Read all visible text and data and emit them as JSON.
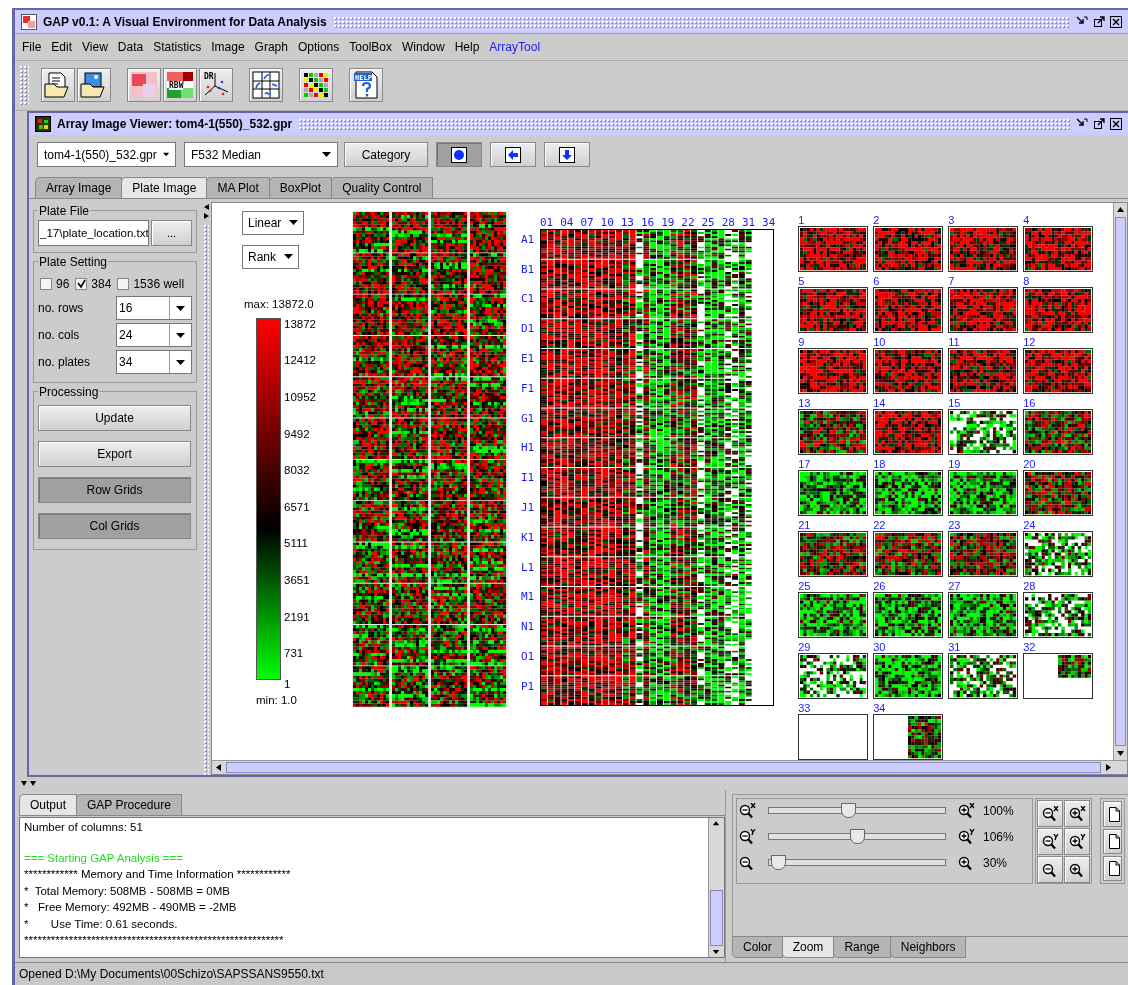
{
  "window": {
    "title": "GAP v0.1: A Visual Environment for Data Analysis"
  },
  "menu": [
    {
      "label": "File",
      "kind": "menu"
    },
    {
      "label": "Edit",
      "kind": "menu"
    },
    {
      "label": "View",
      "kind": "menu"
    },
    {
      "label": "Data",
      "kind": "menu"
    },
    {
      "label": "Statistics",
      "kind": "menu"
    },
    {
      "label": "Image",
      "kind": "menu"
    },
    {
      "label": "Graph",
      "kind": "menu"
    },
    {
      "label": "Options",
      "kind": "menu"
    },
    {
      "label": "ToolBox",
      "kind": "menu"
    },
    {
      "label": "Window",
      "kind": "menu"
    },
    {
      "label": "Help",
      "kind": "menu"
    },
    {
      "label": "ArrayTool",
      "kind": "plugin"
    }
  ],
  "toolbar": [
    {
      "kind": "open"
    },
    {
      "kind": "image"
    },
    {
      "kind": "matrix"
    },
    {
      "kind": "rbw",
      "caption": "RBW"
    },
    {
      "kind": "scatter",
      "caption": "DR"
    },
    {
      "kind": "grid"
    },
    {
      "kind": "palette"
    },
    {
      "kind": "help",
      "caption": "HELP"
    }
  ],
  "viewer": {
    "title": "Array Image Viewer: tom4-1(550)_532.gpr",
    "file_dropdown": "tom4-1(550)_532.gpr",
    "measure_dropdown": "F532 Median",
    "category_button": "Category",
    "tool_buttons": [
      {
        "kind": "dot",
        "selected": true
      },
      {
        "kind": "left",
        "selected": false
      },
      {
        "kind": "down",
        "selected": false
      }
    ],
    "tabs": [
      {
        "label": "Array Image",
        "selected": false
      },
      {
        "label": "Plate Image",
        "selected": true
      },
      {
        "label": "MA Plot",
        "selected": false
      },
      {
        "label": "BoxPlot",
        "selected": false
      },
      {
        "label": "Quality Control",
        "selected": false
      }
    ],
    "plate_file": {
      "title": "Plate File",
      "path": "_17\\plate_location.txt",
      "browse_button": "..."
    },
    "plate_setting": {
      "title": "Plate Setting",
      "wells": [
        {
          "label": "96",
          "checked": false
        },
        {
          "label": "384",
          "checked": true
        },
        {
          "label": "1536 well",
          "checked": false
        }
      ],
      "fields": [
        {
          "label": "no. rows",
          "value": "16"
        },
        {
          "label": "no. cols",
          "value": "24"
        },
        {
          "label": "no. plates",
          "value": "34"
        }
      ]
    },
    "processing": {
      "title": "Processing",
      "buttons": [
        {
          "label": "Update",
          "pressed": false
        },
        {
          "label": "Export",
          "pressed": false
        },
        {
          "label": "Row Grids",
          "pressed": true
        },
        {
          "label": "Col Grids",
          "pressed": true
        }
      ]
    },
    "scale_dropdown": "Linear",
    "order_dropdown": "Rank",
    "color_scale": {
      "max_label": "max: 13872.0",
      "ticks": [
        "13872",
        "12412",
        "10952",
        "9492",
        "8032",
        "6571",
        "5111",
        "3651",
        "2191",
        "731",
        "1"
      ],
      "min_label": "min: 1.0"
    },
    "plate_layout": {
      "columns": [
        "01",
        "04",
        "07",
        "10",
        "13",
        "16",
        "19",
        "22",
        "25",
        "28",
        "31",
        "34"
      ],
      "rows": [
        "A1",
        "B1",
        "C1",
        "D1",
        "E1",
        "F1",
        "G1",
        "H1",
        "I1",
        "J1",
        "K1",
        "L1",
        "M1",
        "N1",
        "O1",
        "P1"
      ]
    },
    "plates": [
      {
        "label": "1",
        "kind": "high"
      },
      {
        "label": "2",
        "kind": "high"
      },
      {
        "label": "3",
        "kind": "high"
      },
      {
        "label": "4",
        "kind": "high"
      },
      {
        "label": "5",
        "kind": "high"
      },
      {
        "label": "6",
        "kind": "high"
      },
      {
        "label": "7",
        "kind": "high"
      },
      {
        "label": "8",
        "kind": "high"
      },
      {
        "label": "9",
        "kind": "high"
      },
      {
        "label": "10",
        "kind": "high"
      },
      {
        "label": "11",
        "kind": "high"
      },
      {
        "label": "12",
        "kind": "high"
      },
      {
        "label": "13",
        "kind": "mixed"
      },
      {
        "label": "14",
        "kind": "high"
      },
      {
        "label": "15",
        "kind": "sparse"
      },
      {
        "label": "16",
        "kind": "mixed"
      },
      {
        "label": "17",
        "kind": "low"
      },
      {
        "label": "18",
        "kind": "low"
      },
      {
        "label": "19",
        "kind": "low"
      },
      {
        "label": "20",
        "kind": "mixed"
      },
      {
        "label": "21",
        "kind": "mixed"
      },
      {
        "label": "22",
        "kind": "mixed"
      },
      {
        "label": "23",
        "kind": "mixed"
      },
      {
        "label": "24",
        "kind": "sparse"
      },
      {
        "label": "25",
        "kind": "low"
      },
      {
        "label": "26",
        "kind": "low"
      },
      {
        "label": "27",
        "kind": "low"
      },
      {
        "label": "28",
        "kind": "sparse"
      },
      {
        "label": "29",
        "kind": "sparse"
      },
      {
        "label": "30",
        "kind": "low"
      },
      {
        "label": "31",
        "kind": "sparse"
      },
      {
        "label": "32",
        "kind": "corner"
      },
      {
        "label": "33",
        "kind": "empty"
      },
      {
        "label": "34",
        "kind": "edge"
      }
    ]
  },
  "output": {
    "tabs": [
      {
        "label": "Output",
        "selected": true
      },
      {
        "label": "GAP Procedure",
        "selected": false
      }
    ],
    "lines": [
      {
        "text": "Number of columns: 51",
        "kind": "plain"
      },
      {
        "text": "=== Starting GAP Analysis ===",
        "kind": "notice"
      },
      {
        "text": "************ Memory and Time Information ************",
        "kind": "plain"
      },
      {
        "text": "*  Total Memory: 508MB - 508MB = 0MB",
        "kind": "plain"
      },
      {
        "text": "*   Free Memory: 492MB - 490MB = -2MB",
        "kind": "plain"
      },
      {
        "text": "*       Use Time: 0.61 seconds.",
        "kind": "plain"
      },
      {
        "text": "**********************************************************",
        "kind": "plain"
      }
    ]
  },
  "zoom": {
    "sliders": [
      {
        "kind": "x",
        "level": 0.45,
        "reading": "100%"
      },
      {
        "kind": "y",
        "level": 0.5,
        "reading": "106%"
      },
      {
        "kind": "both",
        "level": 0.05,
        "reading": "30%"
      }
    ],
    "tabs": [
      {
        "label": "Color",
        "selected": false
      },
      {
        "label": "Zoom",
        "selected": true
      },
      {
        "label": "Range",
        "selected": false
      },
      {
        "label": "Neighbors",
        "selected": false
      }
    ]
  },
  "status_bar": "Opened D:\\My Documents\\00Schizo\\SAPSSANS9550.txt"
}
